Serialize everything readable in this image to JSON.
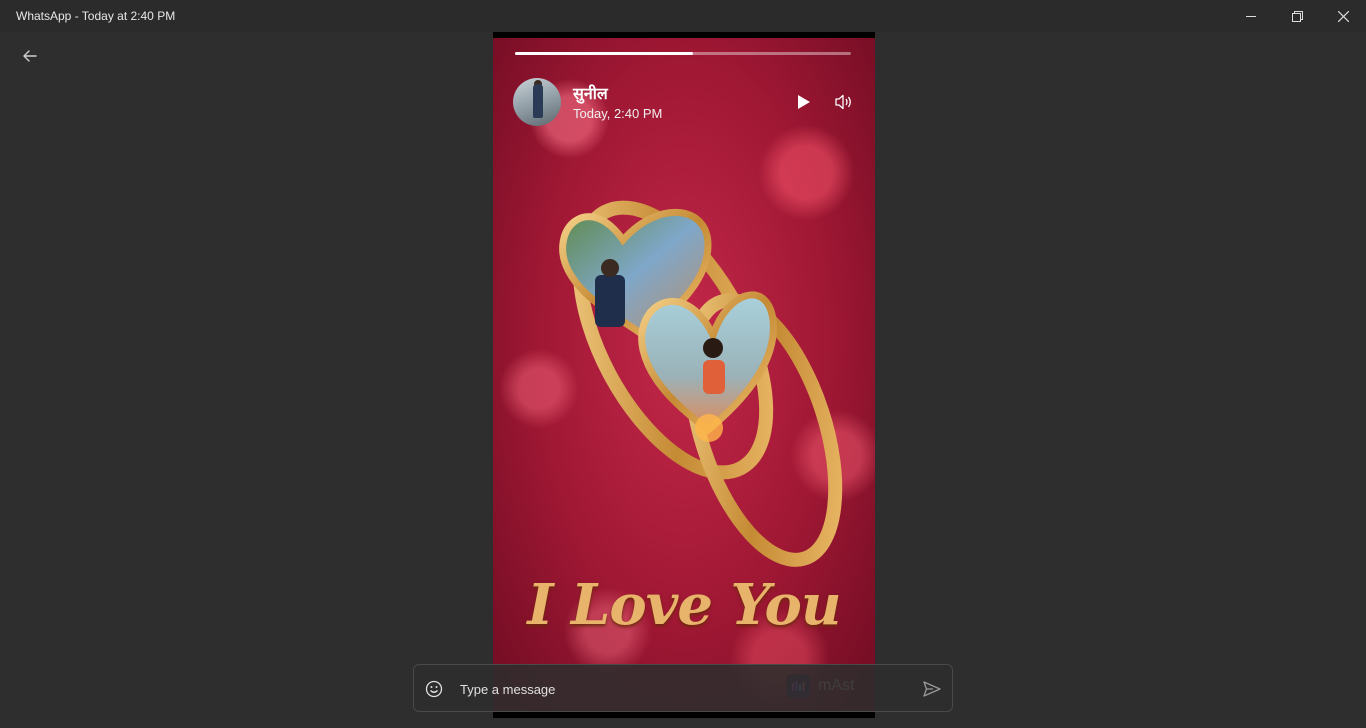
{
  "window": {
    "title": "WhatsApp - Today at 2:40 PM"
  },
  "status": {
    "poster_name": "सुनील",
    "posted_time": "Today, 2:40 PM",
    "progress": 0.53,
    "media_caption": "I Love You",
    "watermark": "mAst"
  },
  "composer": {
    "placeholder": "Type a message"
  },
  "icons": {
    "back": "arrow-left-icon",
    "minimize": "minimize-icon",
    "maximize": "restore-icon",
    "close": "close-icon",
    "play": "play-icon",
    "volume": "volume-icon",
    "emoji": "emoji-icon",
    "send": "send-icon"
  },
  "colors": {
    "background": "#2e2e2e",
    "titlebar": "#2b2b2b",
    "video_red": "#b01f3c",
    "caption_gold": "#e8b36a"
  }
}
